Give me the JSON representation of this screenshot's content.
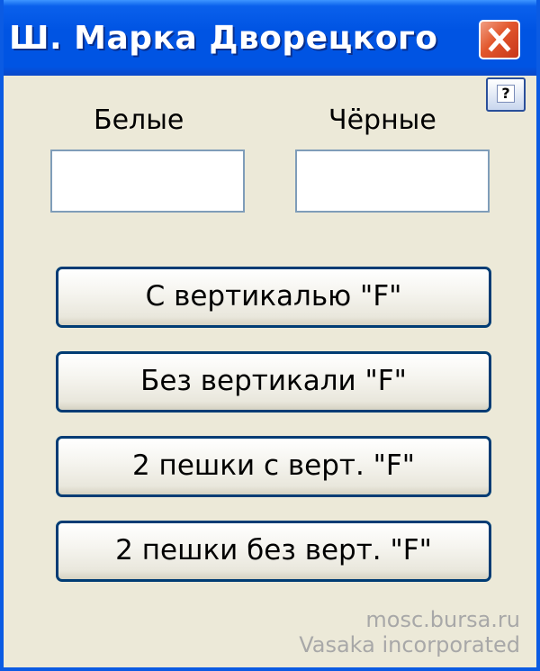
{
  "window": {
    "title": "Ш. Марка Дворецкого",
    "help_label": "?"
  },
  "players": {
    "white_label": "Белые",
    "black_label": "Чёрные",
    "white_value": "",
    "black_value": ""
  },
  "buttons": [
    {
      "label": "С вертикалью \"F\""
    },
    {
      "label": "Без вертикали \"F\""
    },
    {
      "label": "2 пешки с верт. \"F\""
    },
    {
      "label": "2 пешки без верт. \"F\""
    }
  ],
  "credits": {
    "site": "mosc.bursa.ru",
    "author": "Vasaka incorporated"
  },
  "colors": {
    "titlebar": "#0054e3",
    "window_bg": "#ece9d8",
    "close_button": "#e2562c",
    "button_border": "#003c74"
  },
  "icons": {
    "close": "close-icon",
    "help": "help-icon"
  }
}
